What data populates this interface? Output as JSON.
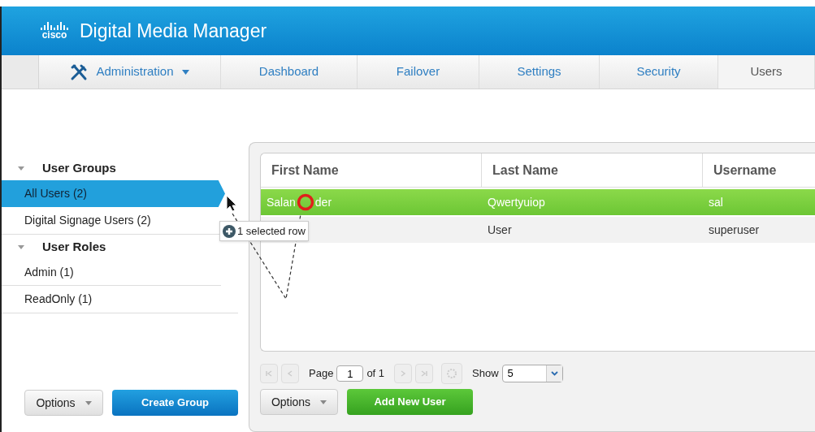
{
  "header": {
    "logo_text": "cisco",
    "title": "Digital Media Manager"
  },
  "nav": [
    {
      "label": "Administration",
      "kind": "menu",
      "selected": false
    },
    {
      "label": "Dashboard",
      "kind": "tab",
      "selected": false
    },
    {
      "label": "Failover",
      "kind": "tab",
      "selected": false
    },
    {
      "label": "Settings",
      "kind": "tab",
      "selected": false
    },
    {
      "label": "Security",
      "kind": "tab",
      "selected": false
    },
    {
      "label": "Users",
      "kind": "tab",
      "selected": true
    }
  ],
  "sidebar": {
    "sections": [
      {
        "title": "User Groups",
        "expanded": true,
        "items": [
          {
            "label": "All Users (2)",
            "selected": true
          },
          {
            "label": "Digital Signage Users (2)",
            "selected": false
          }
        ]
      },
      {
        "title": "User Roles",
        "expanded": true,
        "items": [
          {
            "label": "Admin (1)",
            "selected": false
          },
          {
            "label": "ReadOnly (1)",
            "selected": false
          }
        ]
      }
    ],
    "options_button": "Options",
    "create_button": "Create Group"
  },
  "table": {
    "columns": [
      "First Name",
      "Last Name",
      "Username"
    ],
    "rows": [
      {
        "cells": [
          [
            "Salan",
            "der"
          ],
          "Qwertyuiop",
          "sal"
        ],
        "selected": true
      },
      {
        "cells": [
          null,
          "User",
          "superuser"
        ],
        "selected": false
      }
    ]
  },
  "pager": {
    "page_label": "Page",
    "page": "1",
    "of_label": "of 1",
    "show_label": "Show",
    "show_value": "5"
  },
  "actions": {
    "options_button": "Options",
    "add_button": "Add New User"
  },
  "drag_tooltip": "1 selected row"
}
